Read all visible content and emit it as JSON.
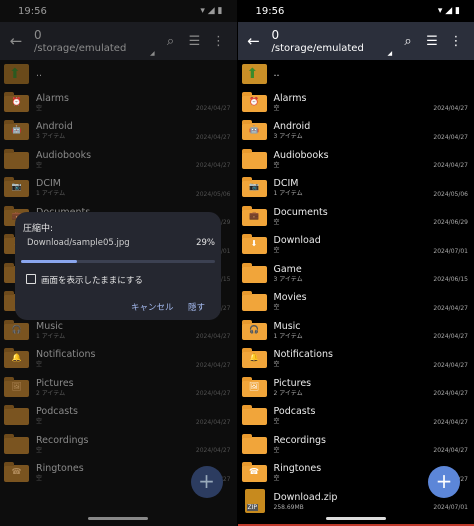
{
  "status_time": "19:56",
  "toolbar": {
    "count": "0",
    "path": "/storage/emulated"
  },
  "parent_label": "..",
  "files": [
    {
      "name": "Alarms",
      "sub": "空",
      "date": "2024/04/27",
      "type": "folder",
      "glyph": "⏰"
    },
    {
      "name": "Android",
      "sub": "3 アイテム",
      "date": "2024/04/27",
      "type": "folder",
      "glyph": "🤖"
    },
    {
      "name": "Audiobooks",
      "sub": "空",
      "date": "2024/04/27",
      "type": "folder",
      "glyph": ""
    },
    {
      "name": "DCIM",
      "sub": "1 アイテム",
      "date": "2024/05/06",
      "type": "folder",
      "glyph": "📷"
    },
    {
      "name": "Documents",
      "sub": "空",
      "date": "2024/06/29",
      "type": "folder",
      "glyph": "💼"
    },
    {
      "name": "Download",
      "sub": "空",
      "date": "2024/07/01",
      "type": "folder",
      "glyph": "⬇"
    },
    {
      "name": "Game",
      "sub": "3 アイテム",
      "date": "2024/06/15",
      "type": "folder",
      "glyph": ""
    },
    {
      "name": "Movies",
      "sub": "空",
      "date": "2024/04/27",
      "type": "folder",
      "glyph": ""
    },
    {
      "name": "Music",
      "sub": "1 アイテム",
      "date": "2024/04/27",
      "type": "folder",
      "glyph": "🎧"
    },
    {
      "name": "Notifications",
      "sub": "空",
      "date": "2024/04/27",
      "type": "folder",
      "glyph": "🔔"
    },
    {
      "name": "Pictures",
      "sub": "2 アイテム",
      "date": "2024/04/27",
      "type": "folder",
      "glyph": "🖼"
    },
    {
      "name": "Podcasts",
      "sub": "空",
      "date": "2024/04/27",
      "type": "folder",
      "glyph": ""
    },
    {
      "name": "Recordings",
      "sub": "空",
      "date": "2024/04/27",
      "type": "folder",
      "glyph": ""
    },
    {
      "name": "Ringtones",
      "sub": "空",
      "date": "2024/04/27",
      "type": "folder",
      "glyph": "☎"
    },
    {
      "name": "Download.zip",
      "sub": "258.69MB",
      "date": "2024/07/01",
      "type": "zip",
      "glyph": "ZIP"
    }
  ],
  "dialog": {
    "title": "圧縮中:",
    "file": "Download/sample05.jpg",
    "percent_label": "29%",
    "progress": 0.29,
    "checkbox_label": "画面を表示したままにする",
    "cancel_label": "キャンセル",
    "hide_label": "隠す"
  },
  "fab_label": "+",
  "icons": {
    "back": "arrow-back-icon",
    "search": "search-icon",
    "list": "list-view-icon",
    "more": "more-vert-icon"
  }
}
